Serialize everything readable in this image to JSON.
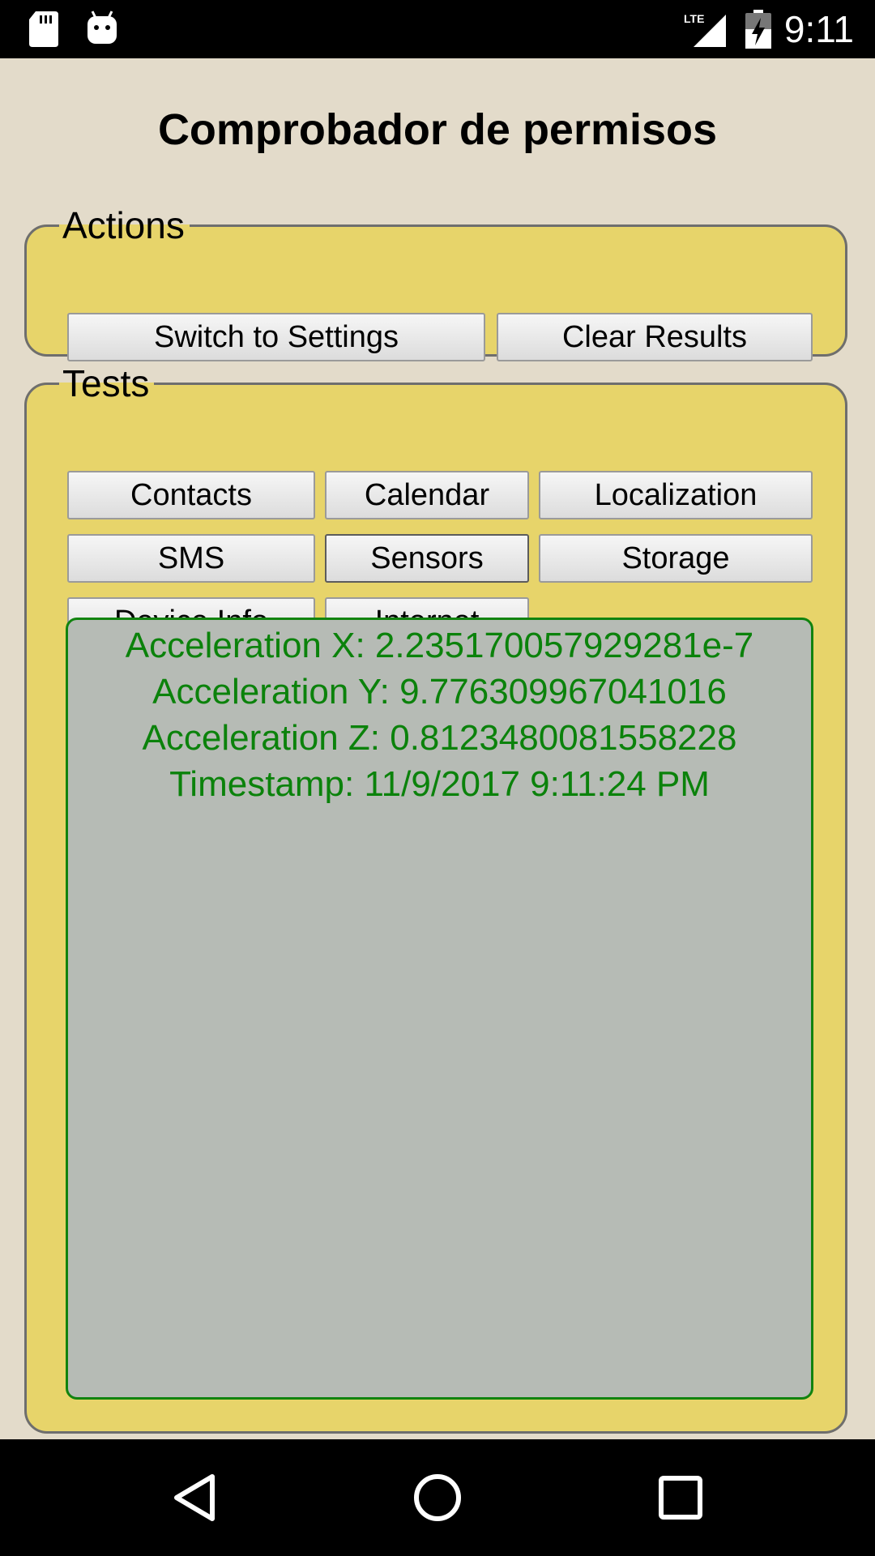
{
  "status_bar": {
    "time": "9:11",
    "network": "LTE",
    "icons": [
      "sd-card-icon",
      "android-debug-icon",
      "lte-signal-icon",
      "battery-charging-icon"
    ]
  },
  "app": {
    "title": "Comprobador de permisos"
  },
  "actions": {
    "legend": "Actions",
    "buttons": {
      "switch_settings": "Switch to Settings",
      "clear_results": "Clear Results"
    }
  },
  "tests": {
    "legend": "Tests",
    "buttons": {
      "contacts": "Contacts",
      "calendar": "Calendar",
      "localization": "Localization",
      "sms": "SMS",
      "sensors": "Sensors",
      "storage": "Storage",
      "device_info": "Device Info",
      "internet": "Internet"
    },
    "selected": "Sensors"
  },
  "results": {
    "lines": [
      "Acceleration X: 2.235170057929281e-7",
      "Acceleration Y: 9.776309967041016",
      "Acceleration Z: 0.8123480081558228",
      "Timestamp: 11/9/2017 9:11:24 PM"
    ]
  },
  "nav_bar": {
    "icons": [
      "back-icon",
      "home-icon",
      "recents-icon"
    ]
  },
  "colors": {
    "page_background": "#e3dbca",
    "group_background": "#e7d46a",
    "results_background": "#b6bbb5",
    "results_text": "#0b820b"
  }
}
